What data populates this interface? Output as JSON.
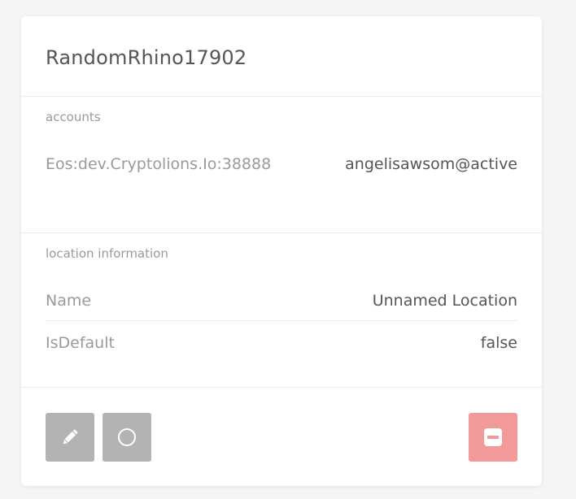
{
  "card": {
    "title": "RandomRhino17902"
  },
  "accounts": {
    "section_label": "accounts",
    "key": "Eos:dev.Cryptolions.Io:38888",
    "value": "angelisawsom@active"
  },
  "location": {
    "section_label": "location information",
    "rows": [
      {
        "label": "Name",
        "value": "Unnamed Location"
      },
      {
        "label": "IsDefault",
        "value": "false"
      }
    ]
  },
  "actions": {
    "edit_icon": "pencil-icon",
    "select_icon": "circle-icon",
    "delete_icon": "minus-square-icon",
    "button_color": "#b3b3b3",
    "danger_color": "#f29a9a"
  }
}
